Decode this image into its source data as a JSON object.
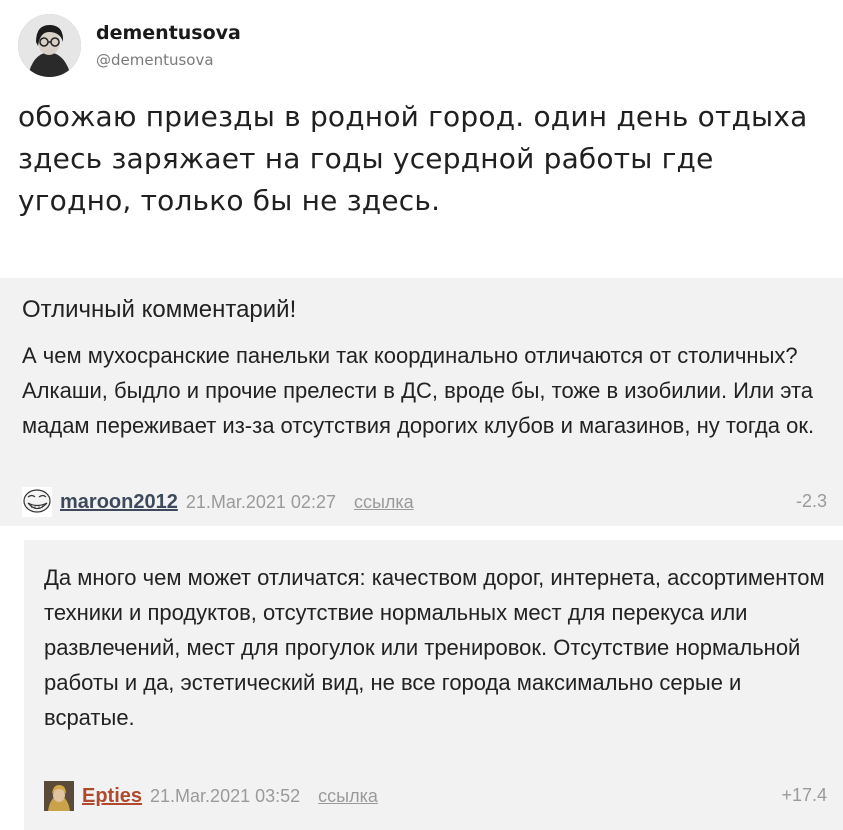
{
  "tweet": {
    "name": "dementusova",
    "handle": "@dementusova",
    "text": "обожаю приезды в родной город. один день отдыха здесь заряжает на годы усердной работы где угодно, только бы не здесь."
  },
  "comments": [
    {
      "title": "Отличный комментарий!",
      "text": "А чем мухосранские панельки так координально отличаются от столичных? Алкаши, быдло и прочие прелести в ДС, вроде бы, тоже в изобилии. Или эта мадам переживает из-за отсутствия дорогих клубов и магазинов, ну тогда ок.",
      "user": "maroon2012",
      "date": "21.Mar.2021 02:27",
      "link": "ссылка",
      "score": "-2.3",
      "avatar_icon": "trollface-icon"
    },
    {
      "text": "Да много чем может отличатся: качеством дорог, интернета, ассортиментом техники и продуктов, отсутствие нормальных мест для перекуса или развлечений, мест для прогулок или тренировок. Отсутствие нормальной работы и да, эстетический вид, не все города максимально серые и всратые.",
      "user": "Epties",
      "date": "21.Mar.2021 03:52",
      "link": "ссылка",
      "score": "+17.4",
      "avatar_icon": "user-photo-icon"
    }
  ],
  "colors": {
    "comment_bg": "#f2f2f2",
    "user_link_dark": "#3d4a5c",
    "user_link_red": "#b04a2e",
    "muted": "#9a9a9a"
  }
}
